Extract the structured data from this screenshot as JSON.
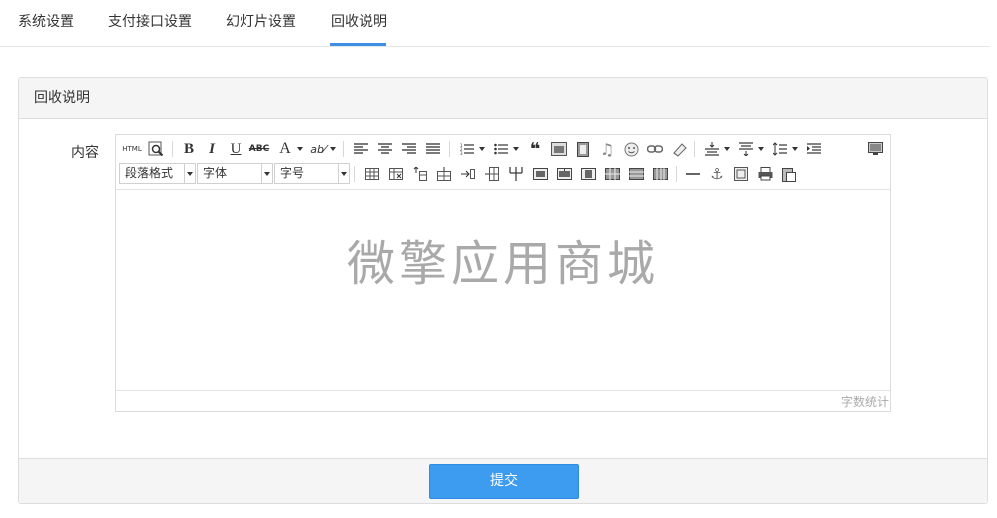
{
  "tabs": [
    {
      "label": "系统设置",
      "active": false
    },
    {
      "label": "支付接口设置",
      "active": false
    },
    {
      "label": "幻灯片设置",
      "active": false
    },
    {
      "label": "回收说明",
      "active": true
    }
  ],
  "panel": {
    "title": "回收说明",
    "field_label": "内容",
    "submit_label": "提交"
  },
  "editor": {
    "html_button": "HTML",
    "paragraph_format": "段落格式",
    "font_family": "字体",
    "font_size": "字号",
    "content_text": "微擎应用商城",
    "word_count_label": "字数统计"
  },
  "colors": {
    "accent": "#3d8fe3",
    "submit": "#3d9bf0",
    "watermark": "#a9a9a9"
  }
}
